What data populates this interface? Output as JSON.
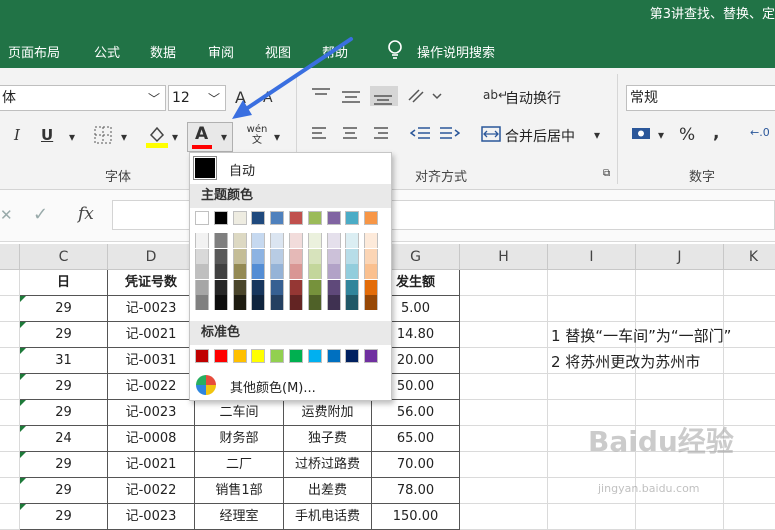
{
  "window": {
    "title": "第3讲查找、替换、定"
  },
  "menu": {
    "tabs": [
      "页面布局",
      "公式",
      "数据",
      "审阅",
      "视图",
      "帮助"
    ],
    "search": "操作说明搜索"
  },
  "ribbon": {
    "font_name": "体",
    "font_size": "12",
    "grow_font": "A",
    "shrink_font": "A",
    "italic": "I",
    "underline": "U",
    "font_color_button": "A",
    "phonetic": "wén 文",
    "font_group_label": "字体",
    "wrap_text": "自动换行",
    "merge_center": "合并后居中",
    "align_group_label": "对齐方式",
    "number_format": "常规",
    "percent": "%",
    "comma": ",",
    "number_group_label": "数字"
  },
  "formula_bar": {
    "cancel": "✕",
    "enter": "✓",
    "fx": "fx",
    "value": ""
  },
  "columns": [
    "C",
    "D",
    "E",
    "F",
    "G",
    "H",
    "I",
    "J",
    "K"
  ],
  "table": {
    "headers": [
      "日",
      "凭证号数",
      "",
      "",
      "发生额"
    ],
    "rows": [
      [
        "29",
        "记-0023",
        "",
        "",
        "5.00"
      ],
      [
        "29",
        "记-0021",
        "",
        "",
        "14.80"
      ],
      [
        "31",
        "记-0031",
        "",
        "",
        "20.00"
      ],
      [
        "29",
        "记-0022",
        "",
        "",
        "50.00"
      ],
      [
        "29",
        "记-0023",
        "二车间",
        "运费附加",
        "56.00"
      ],
      [
        "24",
        "记-0008",
        "财务部",
        "独子费",
        "65.00"
      ],
      [
        "29",
        "记-0021",
        "二厂",
        "过桥过路费",
        "70.00"
      ],
      [
        "29",
        "记-0022",
        "销售1部",
        "出差费",
        "78.00"
      ],
      [
        "29",
        "记-0023",
        "经理室",
        "手机电话费",
        "150.00"
      ]
    ]
  },
  "notes": [
    "1  替换“一车间”为“一部门”",
    "2  将苏州更改为苏州市"
  ],
  "color_panel": {
    "auto_label": "自动",
    "theme_label": "主题颜色",
    "standard_label": "标准色",
    "more_label": "其他颜色(M)...",
    "theme_top": [
      "#FFFFFF",
      "#000000",
      "#EEECE1",
      "#1F497D",
      "#4F81BD",
      "#C0504D",
      "#9BBB59",
      "#8064A2",
      "#4BACC6",
      "#F79646"
    ],
    "theme_shades": [
      [
        "#F2F2F2",
        "#D9D9D9",
        "#BFBFBF",
        "#A6A6A6",
        "#808080"
      ],
      [
        "#7F7F7F",
        "#595959",
        "#404040",
        "#262626",
        "#0D0D0D"
      ],
      [
        "#DDD9C3",
        "#C4BD97",
        "#948A54",
        "#4A452A",
        "#1E1C11"
      ],
      [
        "#C6D9F0",
        "#8DB3E2",
        "#548DD4",
        "#17365D",
        "#0F243E"
      ],
      [
        "#DBE5F1",
        "#B8CCE4",
        "#95B3D7",
        "#366092",
        "#244061"
      ],
      [
        "#F2DCDB",
        "#E5B9B7",
        "#D99694",
        "#953734",
        "#632423"
      ],
      [
        "#EBF1DD",
        "#D7E3BC",
        "#C3D69B",
        "#76923C",
        "#4F6128"
      ],
      [
        "#E5E0EC",
        "#CCC1D9",
        "#B2A2C7",
        "#5F497A",
        "#3F3151"
      ],
      [
        "#DBEEF3",
        "#B7DDE8",
        "#92CDDC",
        "#31859B",
        "#205867"
      ],
      [
        "#FDEADA",
        "#FBD5B5",
        "#FAC08F",
        "#E36C09",
        "#974806"
      ]
    ],
    "standard": [
      "#C00000",
      "#FF0000",
      "#FFC000",
      "#FFFF00",
      "#92D050",
      "#00B050",
      "#00B0F0",
      "#0070C0",
      "#002060",
      "#7030A0"
    ]
  },
  "colors": {
    "accent": "#217346",
    "font_color_bar": "#FF0000",
    "fill_color_bar": "#FFFF00",
    "annotation_arrow": "#3A6FE0"
  },
  "watermark": {
    "brand": "Baidu经验",
    "url": "jingyan.baidu.com"
  }
}
